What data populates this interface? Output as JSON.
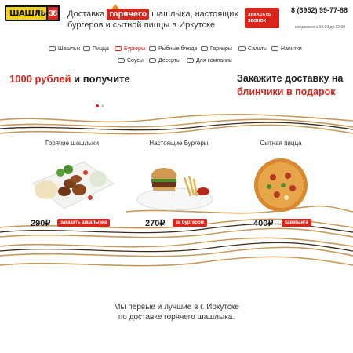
{
  "header": {
    "logo_text": "ШАШЛЫК",
    "logo_num": "38",
    "tagline_before": "Доставка",
    "tagline_hot": "горячего",
    "tagline_after": "шашлыка, настоящих бургеров и сытной пиццы в Иркутске",
    "callback_label_line1": "ЗАКАЗАТЬ",
    "callback_label_line2": "ЗВОНОК",
    "phone": "8 (3952) 99-77-88",
    "hours": "ежедневно с 10:00 до 22:00"
  },
  "nav": {
    "items": [
      {
        "label": "Шашлык",
        "icon": "skewer-icon"
      },
      {
        "label": "Пицца",
        "icon": "pizza-icon"
      },
      {
        "label": "Бургеры",
        "icon": "burger-icon",
        "active": true
      },
      {
        "label": "Рыбные блюда",
        "icon": "fish-icon"
      },
      {
        "label": "Гарниры",
        "icon": "garnish-icon"
      },
      {
        "label": "Салаты",
        "icon": "salad-icon"
      },
      {
        "label": "Напитки",
        "icon": "drink-icon"
      },
      {
        "label": "Соусы",
        "icon": "sauce-icon"
      },
      {
        "label": "Десерты",
        "icon": "dessert-icon"
      },
      {
        "label": "Для компании",
        "icon": "group-icon"
      }
    ]
  },
  "banner": {
    "left_red": "1000 рублей",
    "left_rest": "и получите",
    "right_line1": "Закажите доставку на",
    "right_line2": "блинчики в подарок"
  },
  "products": [
    {
      "title": "Горячие шашлыки",
      "price": "290₽",
      "button": "заказать шашлычка"
    },
    {
      "title": "Настоящие Бургеры",
      "price": "270₽",
      "button": "за бургером"
    },
    {
      "title": "Сытная пицца",
      "price": "400₽",
      "button": "кавабанга"
    }
  ],
  "footer": {
    "line1": "Мы первые и лучшие в г. Иркутске",
    "line2": "по доставке горячего шашлыка."
  },
  "colors": {
    "accent": "#d9251c",
    "logo": "#f2d21b",
    "wave": "#c79a5a"
  }
}
